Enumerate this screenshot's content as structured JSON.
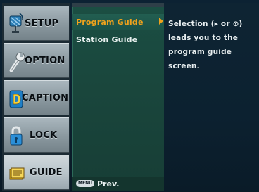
{
  "tabs": [
    {
      "label": "SETUP",
      "icon": "satellite-dish-icon"
    },
    {
      "label": "OPTION",
      "icon": "wrench-icon"
    },
    {
      "label": "CAPTION",
      "icon": "caption-d-icon"
    },
    {
      "label": "LOCK",
      "icon": "padlock-icon"
    },
    {
      "label": "GUIDE",
      "icon": "guide-book-icon"
    }
  ],
  "active_tab": "GUIDE",
  "menu": {
    "items": [
      "Program Guide",
      "Station Guide"
    ],
    "selected": "Program Guide"
  },
  "description": {
    "line1": "Selection (▸ or ⊙)",
    "line2": "leads you to the",
    "line3": "program guide screen."
  },
  "footer": {
    "menu_badge": "MENU",
    "prev_label": "Prev."
  },
  "colors": {
    "accent": "#f0a21c",
    "list_panel": "#1b4e43",
    "desc_panel": "#0c2130"
  }
}
